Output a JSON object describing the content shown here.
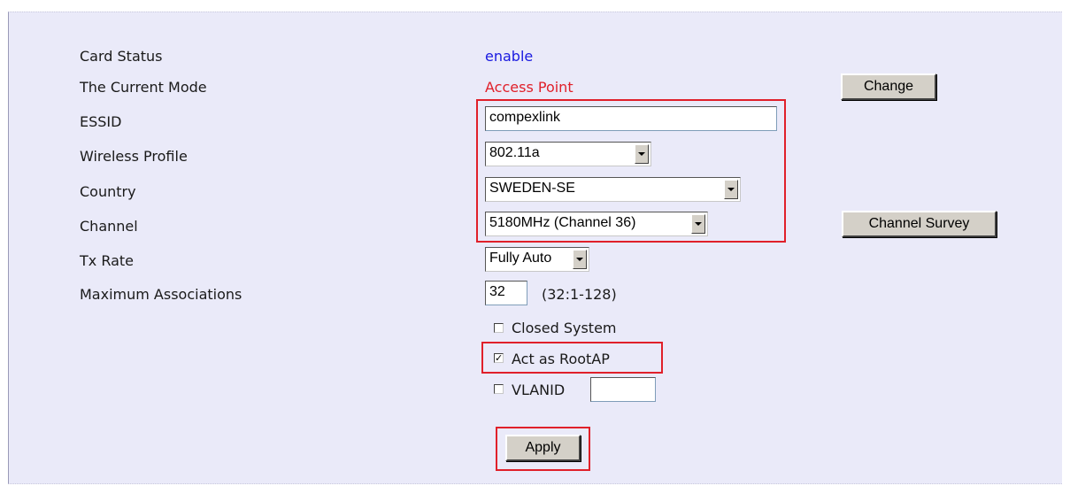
{
  "labels": {
    "card_status": "Card Status",
    "current_mode": "The Current Mode",
    "essid": "ESSID",
    "wireless_profile": "Wireless Profile",
    "country": "Country",
    "channel": "Channel",
    "tx_rate": "Tx Rate",
    "max_assoc": "Maximum Associations"
  },
  "values": {
    "card_status": "enable",
    "current_mode": "Access Point",
    "essid": "compexlink",
    "wireless_profile": "802.11a",
    "country": "SWEDEN-SE",
    "channel": "5180MHz (Channel 36)",
    "tx_rate": "Fully Auto",
    "max_assoc": "32",
    "max_assoc_hint": "(32:1-128)",
    "vlanid": ""
  },
  "checkboxes": {
    "closed_system": {
      "label": "Closed System",
      "checked": false
    },
    "act_as_rootap": {
      "label": "Act as RootAP",
      "checked": true
    },
    "vlanid": {
      "label": "VLANID",
      "checked": false
    }
  },
  "buttons": {
    "change": "Change",
    "channel_survey": "Channel Survey",
    "apply": "Apply"
  },
  "colors": {
    "enable": "#1a1ae0",
    "access_point": "#e0202a",
    "highlight": "#e0202a",
    "panel_bg": "#eaeaf9"
  }
}
